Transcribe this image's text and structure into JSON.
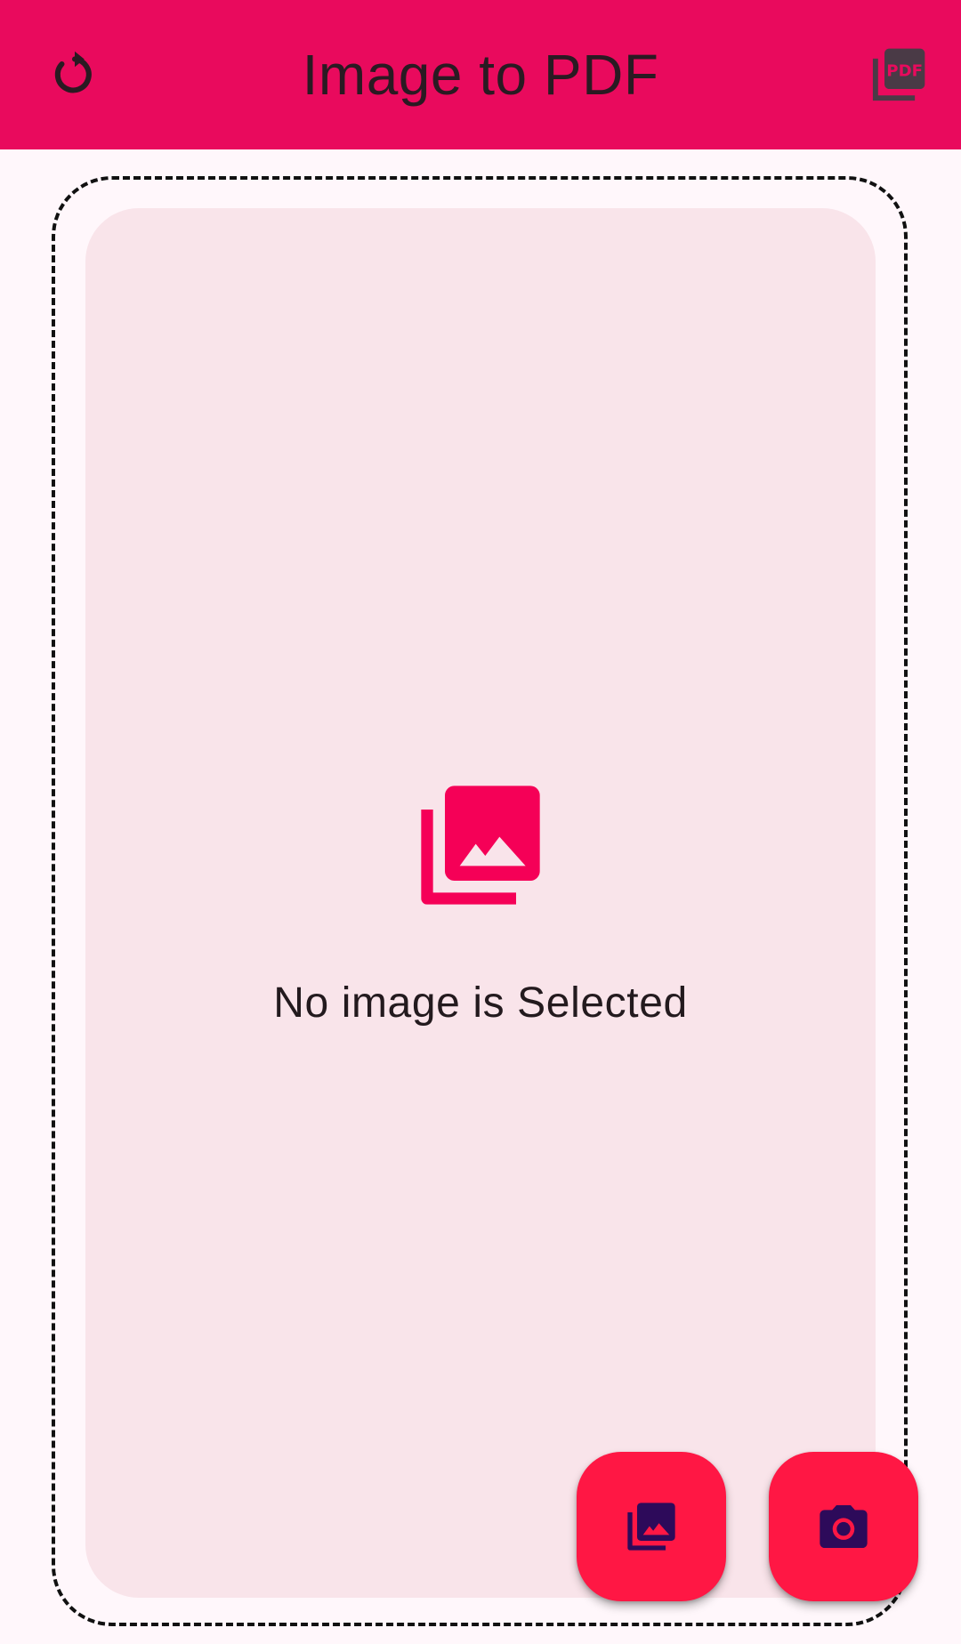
{
  "app_bar": {
    "title": "Image to PDF",
    "left_icon": "refresh-icon",
    "right_icon": "pdf-file-icon",
    "background_color": "#E90A5D"
  },
  "empty_state": {
    "icon": "photo-library-icon",
    "message": "No image is Selected",
    "icon_color": "#F50057"
  },
  "actions": {
    "gallery_icon": "photo-library-icon",
    "camera_icon": "camera-icon",
    "fab_color": "#FF1744",
    "fab_icon_color": "#2D0A5A"
  }
}
